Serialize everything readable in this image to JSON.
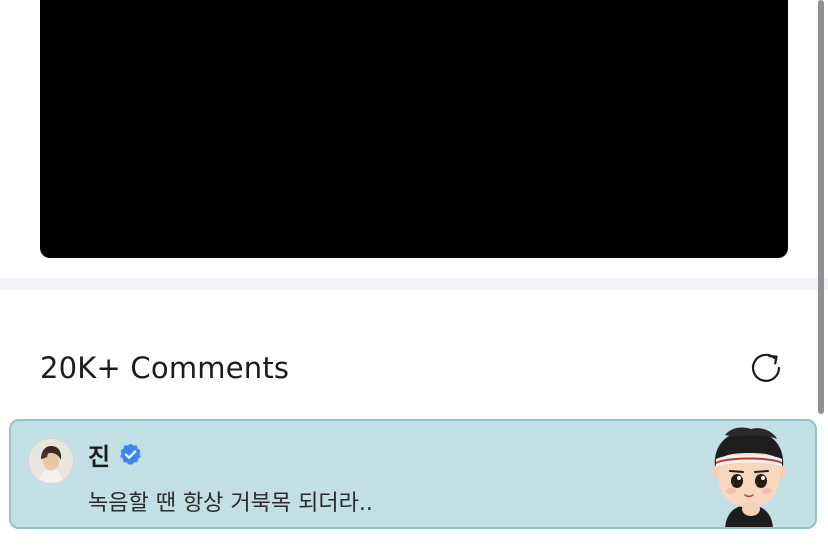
{
  "video": {
    "icon": "video-player"
  },
  "comments": {
    "count_label": "20K+ Comments",
    "refresh_icon": "refresh-icon"
  },
  "highlighted_comment": {
    "author": "진",
    "verified": true,
    "text": "녹음할 땐 항상 거북목 되더라..",
    "avatar_icon": "user-avatar",
    "sticker_icon": "character-sticker",
    "background_color": "#c2e0e3",
    "border_color": "#8fc4cb",
    "badge_color": "#3a86f7"
  }
}
